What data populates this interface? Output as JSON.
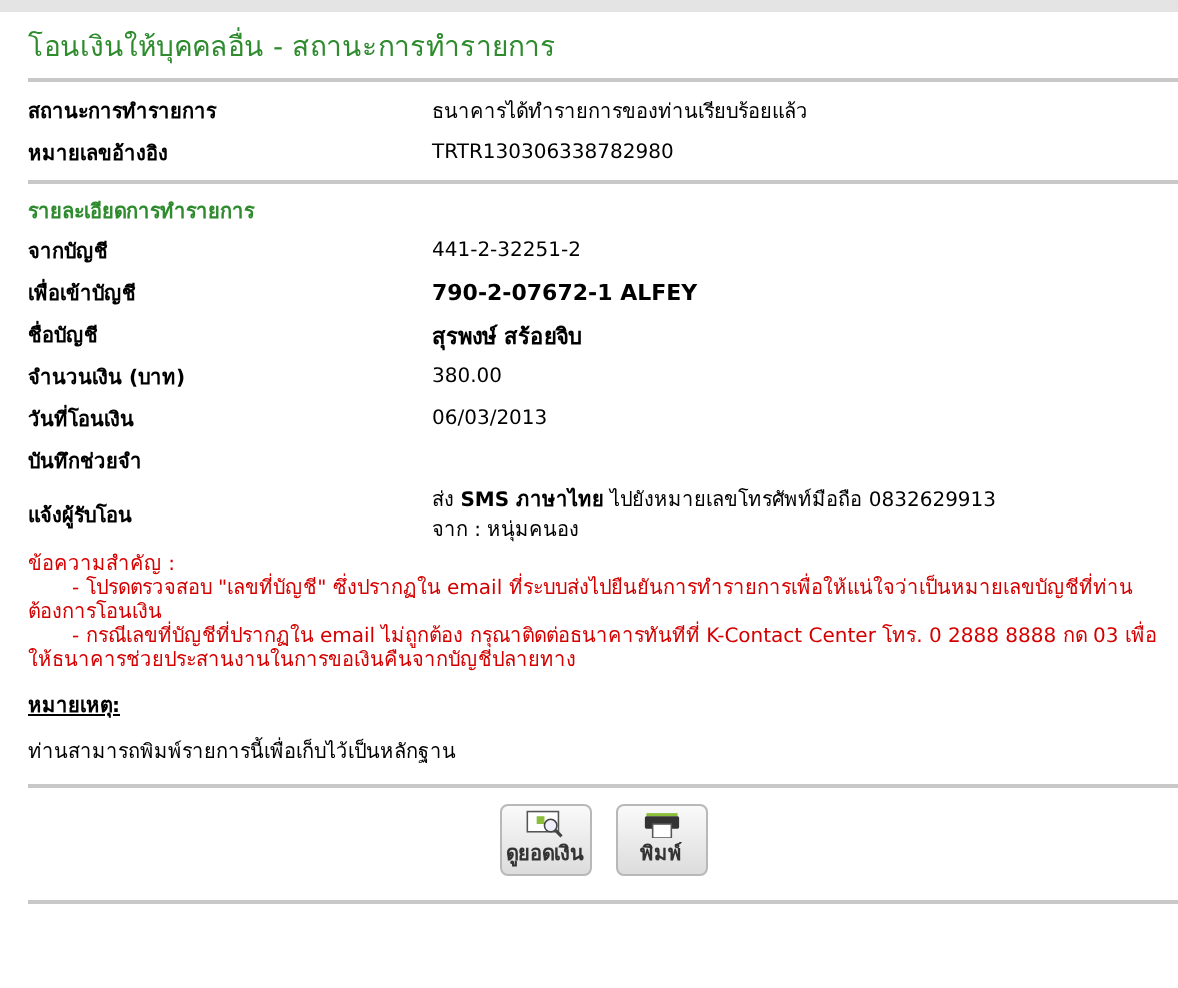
{
  "title": "โอนเงินให้บุคคลอื่น - สถานะการทำรายการ",
  "summary": [
    {
      "label": "สถานะการทำรายการ",
      "value": "ธนาคารได้ทำรายการของท่านเรียบร้อยแล้ว"
    },
    {
      "label": "หมายเลขอ้างอิง",
      "value": "TRTR130306338782980"
    }
  ],
  "details_heading": "รายละเอียดการทำรายการ",
  "details": [
    {
      "label": "จากบัญชี",
      "value": "441-2-32251-2",
      "bold": false
    },
    {
      "label": "เพื่อเข้าบัญชี",
      "value": "790-2-07672-1 ALFEY",
      "bold": true
    },
    {
      "label": "ชื่อบัญชี",
      "value": "สุรพงษ์ สร้อยจิบ",
      "bold": true
    },
    {
      "label": "จำนวนเงิน (บาท)",
      "value": "380.00",
      "bold": false
    },
    {
      "label": "วันที่โอนเงิน",
      "value": "06/03/2013",
      "bold": false
    },
    {
      "label": "บันทึกช่วยจำ"
    },
    {
      "label": "แจ้งผู้รับโอน",
      "value": "ส่ง **SMS ภาษาไทย** ไปยังหมายเลขโทรศัพท์มือถือ 0832629913",
      "value2": "จาก : หนุ่มคนอง",
      "bold": false
    }
  ],
  "important": {
    "heading": "ข้อความสำคัญ :",
    "items": [
      "- โปรดตรวจสอบ \"เลขที่บัญชี\" ซึ่งปรากฏใน email ที่ระบบส่งไปยืนยันการทำรายการเพื่อให้แน่ใจว่าเป็นหมายเลขบัญชีที่ท่านต้องการโอนเงิน",
      "- กรณีเลขที่บัญชีที่ปรากฏใน email ไม่ถูกต้อง กรุณาติดต่อธนาคารทันทีที่ K-Contact Center โทร. 0 2888 8888 กด 03 เพื่อให้ธนาคารช่วยประสานงานในการขอเงินคืนจากบัญชีปลายทาง"
    ]
  },
  "note": {
    "heading": "หมายเหตุ:",
    "text": "ท่านสามารถพิมพ์รายการนี้เพื่อเก็บไว้เป็นหลักฐาน"
  },
  "buttons": [
    {
      "kind": "balance",
      "label": "ดูยอดเงิน"
    },
    {
      "kind": "print",
      "label": "พิมพ์"
    }
  ]
}
